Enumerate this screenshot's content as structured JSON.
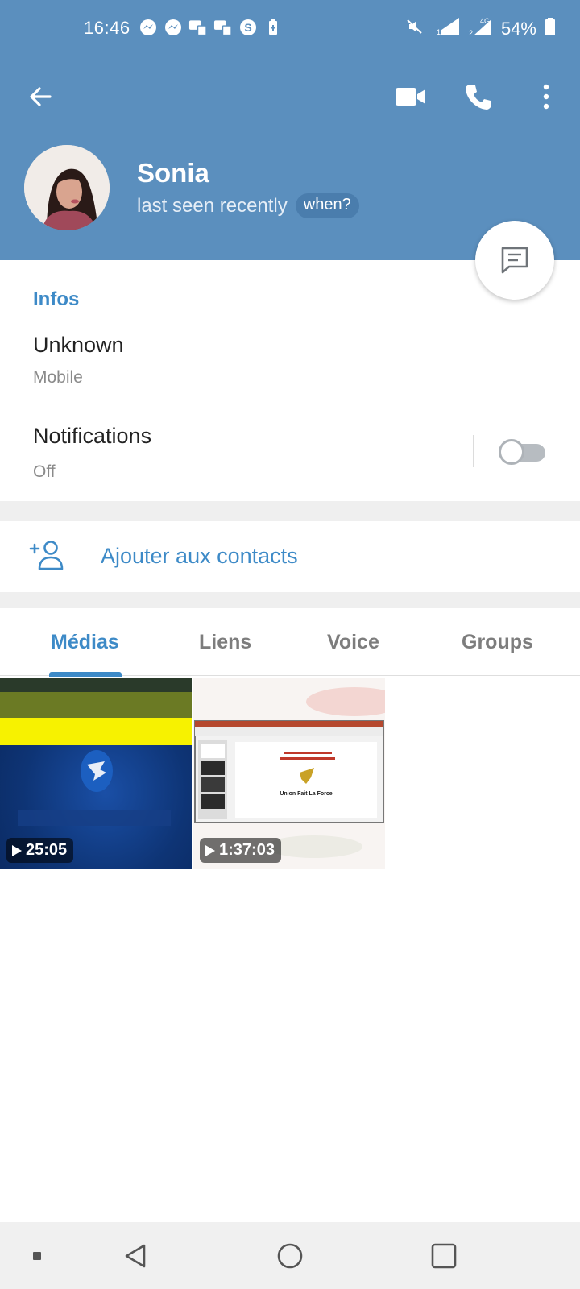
{
  "status_bar": {
    "time": "16:46",
    "battery": "54%",
    "network": "4G"
  },
  "profile": {
    "name": "Sonia",
    "status": "last seen recently",
    "when_chip": "when?"
  },
  "info": {
    "section_title": "Infos",
    "phone_value": "Unknown",
    "phone_label": "Mobile",
    "notifications_label": "Notifications",
    "notifications_value": "Off",
    "notifications_enabled": false
  },
  "add_contact": {
    "label": "Ajouter aux contacts"
  },
  "tabs": [
    {
      "label": "Médias",
      "active": true
    },
    {
      "label": "Liens",
      "active": false
    },
    {
      "label": "Voice",
      "active": false
    },
    {
      "label": "Groups",
      "active": false
    }
  ],
  "media": [
    {
      "duration": "25:05"
    },
    {
      "duration": "1:37:03",
      "slide_caption": "Union Fait La Force"
    }
  ],
  "colors": {
    "header": "#5b8fbe",
    "accent": "#3d8ac7"
  }
}
